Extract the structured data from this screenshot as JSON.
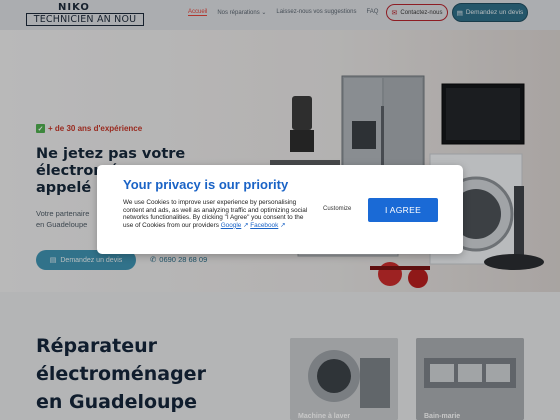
{
  "header": {
    "logo_top": "NIKO",
    "logo_bottom": "TECHNICIEN AN NOU",
    "nav": [
      {
        "label": "Accueil",
        "active": true
      },
      {
        "label": "Nos réparations",
        "active": false
      },
      {
        "label": "Laissez-nous vos suggestions",
        "active": false
      },
      {
        "label": "FAQ",
        "active": false
      }
    ],
    "contact_label": "Contactez-nous",
    "devis_label": "Demandez un devis"
  },
  "hero": {
    "experience": "+ de 30 ans d'expérience",
    "title_lines": [
      "Ne jetez pas votre",
      "électroménager,",
      "appelé Niko !"
    ],
    "subtitle_lines": [
      "Votre partenaire",
      "en Guadeloupe"
    ],
    "devis_label": "Demandez un devis",
    "phone": "0690 28 68 09"
  },
  "lower": {
    "title_lines": [
      "Réparateur",
      "électroménager",
      "en Guadeloupe"
    ],
    "cards": [
      {
        "label": "Machine à laver"
      },
      {
        "label": "Bain-marie"
      }
    ]
  },
  "modal": {
    "title": "Your privacy is our priority",
    "text_before": "We use Cookies to improve user experience by personalising content and ads, as well as analyzing traffic and optimizing social networks functionalities. By clicking \"I Agree\" you consent to the use of Cookies from our providers ",
    "link_google": "Google",
    "link_facebook": "Facebook",
    "customize_label": "Customize",
    "agree_label": "I AGREE"
  },
  "colors": {
    "primary_blue": "#1a6ad6",
    "accent_red": "#e3443a",
    "teal": "#2f6f88"
  }
}
